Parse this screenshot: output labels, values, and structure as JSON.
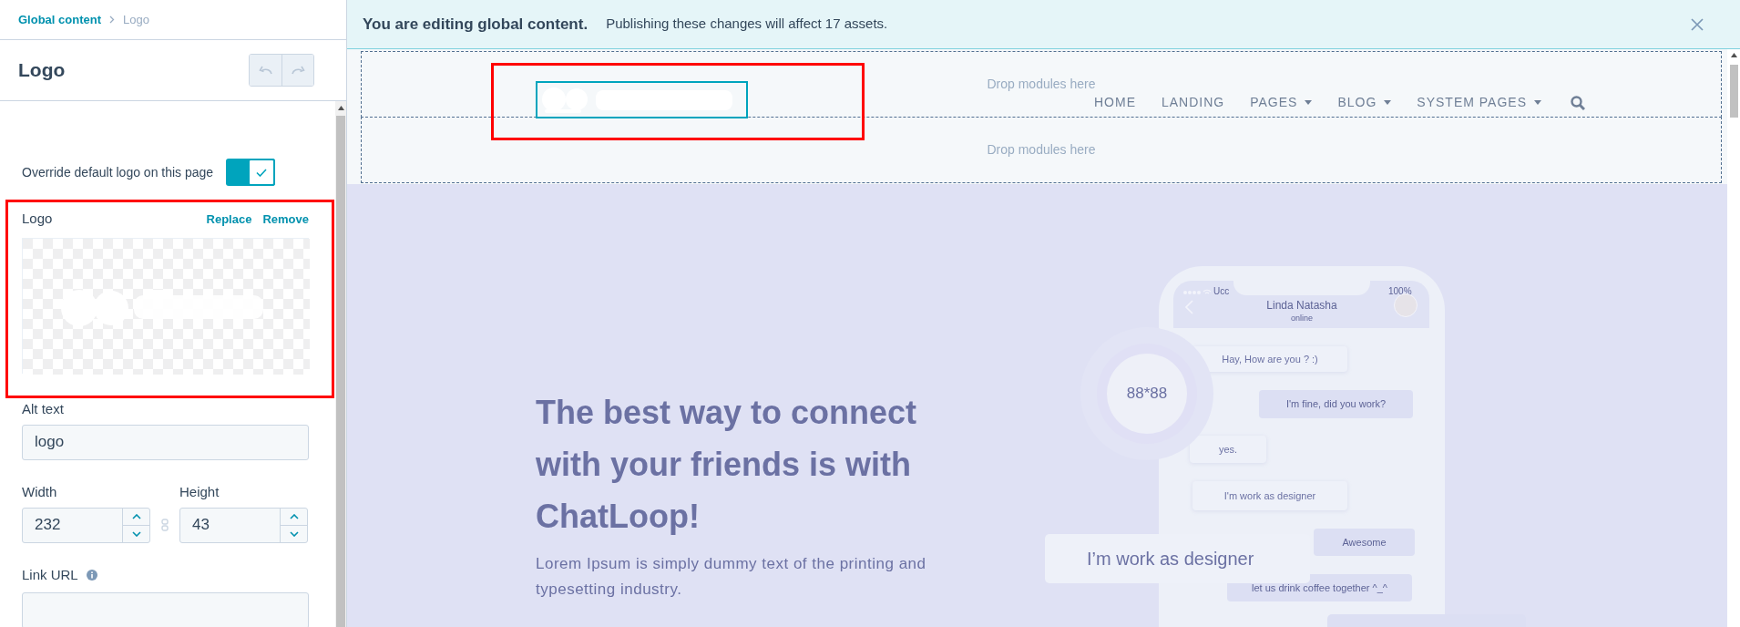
{
  "sidebar": {
    "breadcrumb": [
      {
        "label": "Global content",
        "current": false
      },
      {
        "label": "Logo",
        "current": true
      }
    ],
    "title": "Logo",
    "history_buttons": [
      {
        "kind": "undo"
      },
      {
        "kind": "redo"
      }
    ],
    "toggle": {
      "label": "Override default logo on this page",
      "on": true
    },
    "logo_field": {
      "label": "Logo",
      "actions": [
        "Replace",
        "Remove"
      ],
      "preview": {
        "kind": "picture"
      }
    },
    "alt_text": {
      "label": "Alt text",
      "value": "logo"
    },
    "width": {
      "label": "Width",
      "value": "232"
    },
    "height": {
      "label": "Height",
      "value": "43"
    },
    "link_url": {
      "label": "Link URL"
    }
  },
  "banner": {
    "title": "You are editing global content.",
    "message": "Publishing these changes will affect 17 assets."
  },
  "canvas": {
    "drop_zones": [
      "Drop modules here",
      "Drop modules here"
    ],
    "logo": {
      "kind": "picture",
      "selected": true
    },
    "nav": [
      {
        "label": "HOME",
        "dropdown": false
      },
      {
        "label": "LANDING",
        "dropdown": false
      },
      {
        "label": "PAGES",
        "dropdown": true
      },
      {
        "label": "BLOG",
        "dropdown": true
      },
      {
        "label": "SYSTEM PAGES",
        "dropdown": true
      }
    ],
    "hero": {
      "heading": "The best way to connect with your friends is with ChatLoop!",
      "body": "Lorem Ipsum is simply dummy text of the printing and typesetting industry.",
      "badge": "88*88",
      "phone": {
        "carrier": "Ucc",
        "battery": "100%",
        "contact": "Linda Natasha",
        "presence": "online",
        "messages": [
          {
            "kind": "received",
            "text": "Hay, How are you ? :)"
          },
          {
            "kind": "sent",
            "text": "I'm fine, did you work?"
          },
          {
            "kind": "received",
            "text": "yes."
          },
          {
            "kind": "received",
            "text": "I'm work as designer"
          },
          {
            "kind": "sent",
            "text": "Awesome"
          },
          {
            "kind": "sent",
            "text": "let us drink coffee together ^_^"
          }
        ]
      },
      "callout": "I’m work as designer"
    }
  }
}
